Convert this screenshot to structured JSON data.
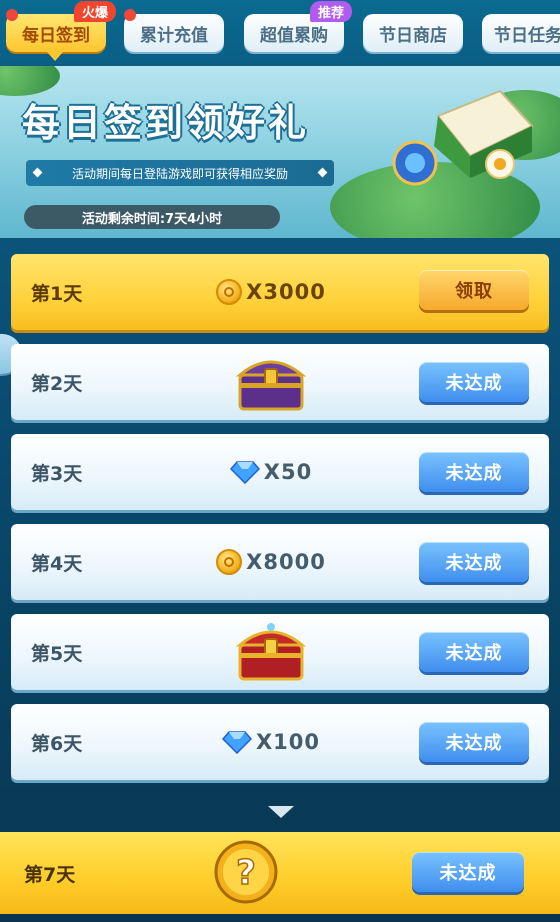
{
  "tabs": [
    {
      "label": "每日签到",
      "active": true,
      "badge": "火爆"
    },
    {
      "label": "累计充值"
    },
    {
      "label": "超值累购",
      "badge": "推荐"
    },
    {
      "label": "节日商店"
    },
    {
      "label": "节日任务"
    }
  ],
  "banner": {
    "title": "每日签到领好礼",
    "description": "活动期间每日登陆游戏即可获得相应奖励",
    "countdown": "活动剩余时间:7天4小时"
  },
  "days": [
    {
      "day": "第1天",
      "reward_type": "coin",
      "amount": "X3000",
      "button": "领取",
      "claimable": true
    },
    {
      "day": "第2天",
      "reward_type": "chest-purple",
      "amount": "",
      "button": "未达成"
    },
    {
      "day": "第3天",
      "reward_type": "diamond",
      "amount": "X50",
      "button": "未达成"
    },
    {
      "day": "第4天",
      "reward_type": "coin",
      "amount": "X8000",
      "button": "未达成"
    },
    {
      "day": "第5天",
      "reward_type": "chest-red",
      "amount": "",
      "button": "未达成"
    },
    {
      "day": "第6天",
      "reward_type": "diamond",
      "amount": "X100",
      "button": "未达成"
    },
    {
      "day": "第7天",
      "reward_type": "mystery",
      "amount": "",
      "button": "未达成"
    }
  ],
  "colors": {
    "active_tab": "#ffc52e",
    "claim_button": "#f6a92c",
    "locked_button": "#3f8eee",
    "background": "#0a4d73"
  }
}
